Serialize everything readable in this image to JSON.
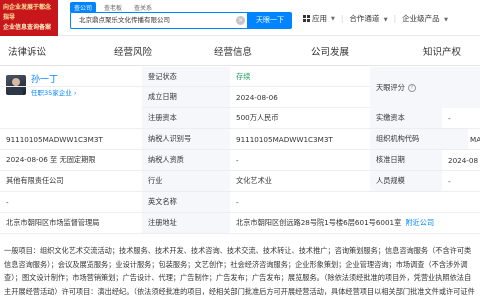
{
  "banner": {
    "line1": "向企业发展于都念指导",
    "line2": "企业信息查询备案"
  },
  "search": {
    "tabs": [
      "查公司",
      "查老板",
      "查关系"
    ],
    "query": "北京鼎点聚乐文化传播有限公司",
    "clear_icon": "close-icon",
    "button": "天眼一下"
  },
  "top_nav": {
    "apps": "应用",
    "cooperation": "合作通道",
    "enterprise": "企业级产品"
  },
  "tabs": [
    "法律诉讼",
    "经营风险",
    "经营信息",
    "公司发展",
    "知识产权"
  ],
  "rows": {
    "legal_rep": {
      "name": "孙一丁",
      "sub": "任职35家企业 ›"
    },
    "status": {
      "label": "登记状态",
      "value": "存续",
      "color": "#19a15f"
    },
    "score": {
      "label": "天眼评分"
    },
    "established": {
      "label": "成立日期",
      "value": "2024-08-06"
    },
    "reg_capital": {
      "label": "注册资本",
      "value": "500万人民币"
    },
    "paid_capital": {
      "label": "实缴资本",
      "value": "-"
    },
    "credit_code": {
      "value": "91110105MADWW1C3M3T"
    },
    "tax_id": {
      "label": "纳税人识别号",
      "value": "91110105MADWW1C3M3T"
    },
    "org_code": {
      "label": "组织机构代码",
      "value": "MA"
    },
    "term": {
      "value": "2024-08-06 至 无固定期限"
    },
    "taxpayer": {
      "label": "纳税人资质",
      "value": "-"
    },
    "approval": {
      "label": "核准日期",
      "value": "2024-08"
    },
    "company_type": {
      "value": "其他有限责任公司"
    },
    "industry": {
      "label": "行业",
      "value": "文化艺术业"
    },
    "staff": {
      "label": "人员规模",
      "value": "-"
    },
    "insured": {
      "value": "-"
    },
    "english_name": {
      "label": "英文名称",
      "value": "-"
    },
    "authority": {
      "value": "北京市朝阳区市场监督管理局"
    },
    "address": {
      "label": "注册地址",
      "value": "北京市朝阳区创远路28号院1号楼6层601号6001室",
      "link": "附近公司"
    }
  },
  "scope_text": "一般项目：组织文化艺术交流活动；技术服务、技术开发、技术咨询、技术交流、技术转让、技术推广；咨询策划服务；信息咨询服务（不含许可类信息咨询服务）；会议及展览服务；业设计服务；包装服务；文艺创作；社会经济咨询服务；企业形象策划；企业管理咨询；市场调查（不含涉外调查）；图文设计制作；市场营销策划；广告设计、代理；广告制作；广告发布；广告发布；展览服务。（除依法须经批准的项目外，凭营业执照依法自主开展经营活动）许可项目：演出经纪。（依法须经批准的项目，经相关部门批准后方可开展经营活动，具体经营项目以相关部门批准文件或许可证件为准）（不得从事国家和本市产业政策禁止和限制类项目的经营活动。）"
}
